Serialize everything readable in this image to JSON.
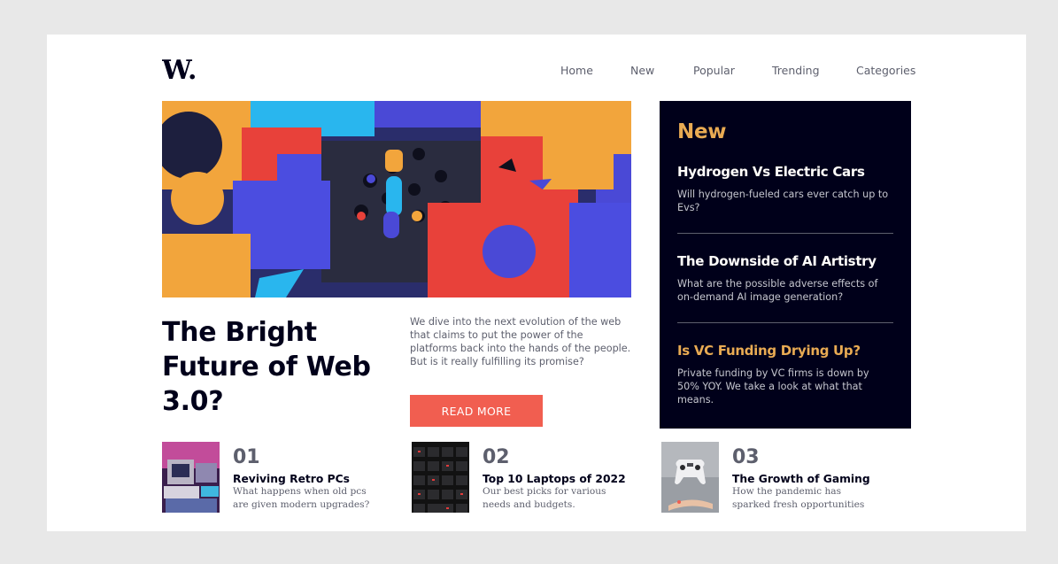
{
  "logo": {
    "text": "W."
  },
  "nav": {
    "items": [
      "Home",
      "New",
      "Popular",
      "Trending",
      "Categories"
    ]
  },
  "hero": {
    "image_alt": "abstract 3D blocks illustration",
    "title": "The Bright Future of Web 3.0?",
    "description": "We dive into the next evolution of the web that claims to put the power of the platforms back into the hands of the people. But is it really fulfilling its promise?",
    "button_label": "Read more"
  },
  "new_panel": {
    "heading": "New",
    "items": [
      {
        "title": "Hydrogen Vs Electric Cars",
        "description": "Will hydrogen-fueled cars ever catch up to Evs?"
      },
      {
        "title": "The Downside of AI Artistry",
        "description": "What are the possible adverse effects of on-demand AI image generation?"
      },
      {
        "title": "Is VC Funding Drying Up?",
        "description": "Private funding by VC firms is down by 50% YOY. We take a look at what that means."
      }
    ]
  },
  "bottom": {
    "items": [
      {
        "number": "01",
        "title": "Reviving Retro PCs",
        "description": "What happens when old pcs are given modern upgrades?"
      },
      {
        "number": "02",
        "title": "Top 10 Laptops of 2022",
        "description": "Our best picks for various needs and budgets."
      },
      {
        "number": "03",
        "title": "The Growth of Gaming",
        "description": "How the pandemic has sparked fresh opportunities"
      }
    ]
  },
  "colors": {
    "background": "#e8e8e8",
    "card": "#ffffff",
    "dark": "#00001a",
    "accent_orange": "#e9ab53",
    "accent_red": "#f15e50",
    "muted": "#5d5f6d"
  }
}
